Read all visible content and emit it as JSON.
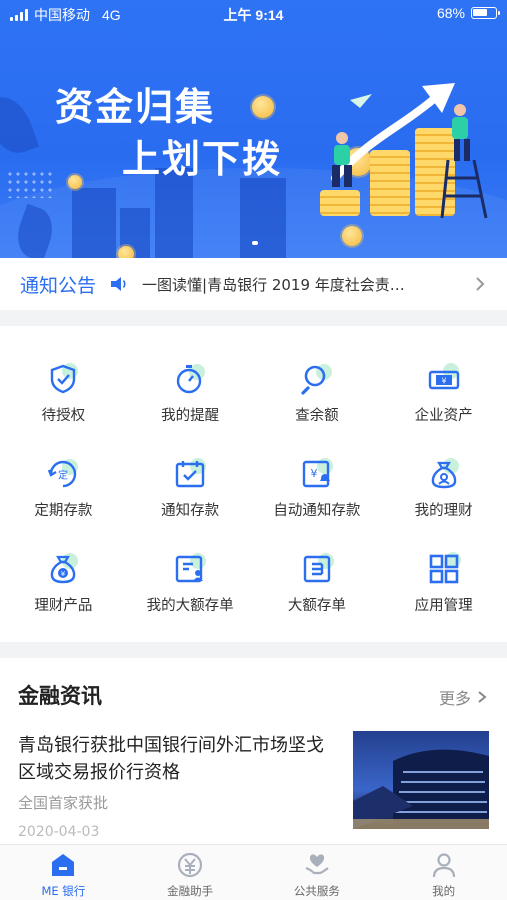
{
  "status_bar": {
    "carrier": "中国移动",
    "network": "4G",
    "time": "上午 9:14",
    "battery": "68%",
    "battery_fraction": 0.68
  },
  "banner": {
    "line1": "资金归集",
    "line2": "上划下拨"
  },
  "notice": {
    "title": "通知公告",
    "text": "一图读懂|青岛银行 2019 年度社会责…"
  },
  "services": [
    {
      "label": "待授权",
      "icon": "shield-check-icon"
    },
    {
      "label": "我的提醒",
      "icon": "stopwatch-icon"
    },
    {
      "label": "查余额",
      "icon": "magnifier-icon"
    },
    {
      "label": "企业资产",
      "icon": "banknote-icon"
    },
    {
      "label": "定期存款",
      "icon": "fixed-deposit-icon"
    },
    {
      "label": "通知存款",
      "icon": "calendar-check-icon"
    },
    {
      "label": "自动通知存款",
      "icon": "auto-notice-deposit-icon"
    },
    {
      "label": "我的理财",
      "icon": "wealth-bag-icon"
    },
    {
      "label": "理财产品",
      "icon": "money-bag-icon"
    },
    {
      "label": "我的大额存单",
      "icon": "large-cd-person-icon"
    },
    {
      "label": "大额存单",
      "icon": "large-cd-icon"
    },
    {
      "label": "应用管理",
      "icon": "app-grid-icon"
    }
  ],
  "news": {
    "section_title": "金融资讯",
    "more_label": "更多",
    "headline": "青岛银行获批中国银行间外汇市场坚戈区域交易报价行资格",
    "subtitle": "全国首家获批",
    "date": "2020-04-03"
  },
  "tabbar": [
    {
      "label": "ME 银行",
      "icon": "bank-home-icon",
      "active": true
    },
    {
      "label": "金融助手",
      "icon": "yuan-coin-icon",
      "active": false
    },
    {
      "label": "公共服务",
      "icon": "heart-hand-icon",
      "active": false
    },
    {
      "label": "我的",
      "icon": "person-icon",
      "active": false
    }
  ],
  "colors": {
    "primary": "#2b6ef0",
    "accent_light": "#c9f0dd",
    "banner": "#2f73f5"
  }
}
